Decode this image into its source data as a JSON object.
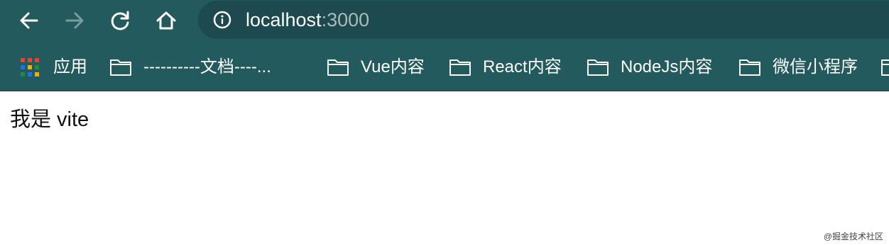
{
  "toolbar": {
    "back_icon": "arrow-left-icon",
    "forward_icon": "arrow-right-icon",
    "reload_icon": "reload-icon",
    "home_icon": "home-icon"
  },
  "omnibox": {
    "info_icon": "info-circle-icon",
    "host": "localhost",
    "port": ":3000"
  },
  "bookmarks": {
    "apps_icon": "apps-grid-icon",
    "items": [
      {
        "label": "应用",
        "icon": "apps-grid-icon"
      },
      {
        "label": "----------文档----...",
        "icon": "folder-icon"
      },
      {
        "label": "Vue内容",
        "icon": "folder-icon"
      },
      {
        "label": "React内容",
        "icon": "folder-icon"
      },
      {
        "label": "NodeJs内容",
        "icon": "folder-icon"
      },
      {
        "label": "微信小程序",
        "icon": "folder-icon"
      }
    ]
  },
  "page": {
    "content": "我是 vite"
  },
  "watermark": "@掘金技术社区",
  "colors": {
    "chrome": "#235a5e",
    "omnibox": "#1d4a4e",
    "port_text": "#a8bcbd",
    "forward_disabled": "#7a9c9e"
  }
}
